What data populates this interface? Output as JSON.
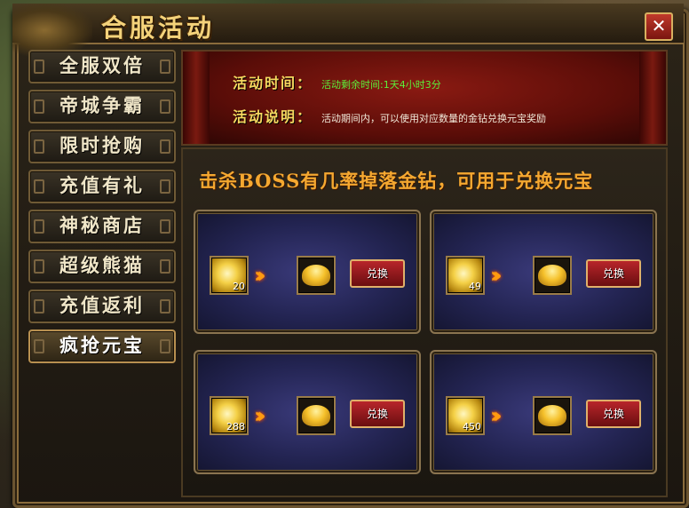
{
  "window": {
    "title": "合服活动",
    "close_label": "✕"
  },
  "sidebar": {
    "items": [
      {
        "label": "全服双倍",
        "active": false
      },
      {
        "label": "帝城争霸",
        "active": false
      },
      {
        "label": "限时抢购",
        "active": false
      },
      {
        "label": "充值有礼",
        "active": false
      },
      {
        "label": "神秘商店",
        "active": false
      },
      {
        "label": "超级熊猫",
        "active": false
      },
      {
        "label": "充值返利",
        "active": false
      },
      {
        "label": "疯抢元宝",
        "active": true
      }
    ]
  },
  "info": {
    "time_label": "活动时间：",
    "time_value": "活动剩余时间:1天4小时3分",
    "desc_label": "活动说明：",
    "desc_value": "活动期间内，可以使用对应数量的金钻兑换元宝奖励"
  },
  "main": {
    "banner": "击杀BOSS有几率掉落金钻，可用于兑换元宝",
    "cards": [
      {
        "cost": "20",
        "button": "兑换"
      },
      {
        "cost": "49",
        "button": "兑换"
      },
      {
        "cost": "288",
        "button": "兑换"
      },
      {
        "cost": "450",
        "button": "兑换"
      }
    ]
  },
  "colors": {
    "accent_gold": "#f5d860",
    "time_green": "#5cf03a",
    "banner_orange": "#f5a830",
    "button_red": "#b8252a"
  },
  "icons": {
    "cost_item": "gold-diamond-icon",
    "reward_item": "gold-ingot-icon",
    "arrow": "double-chevron-right-icon"
  }
}
